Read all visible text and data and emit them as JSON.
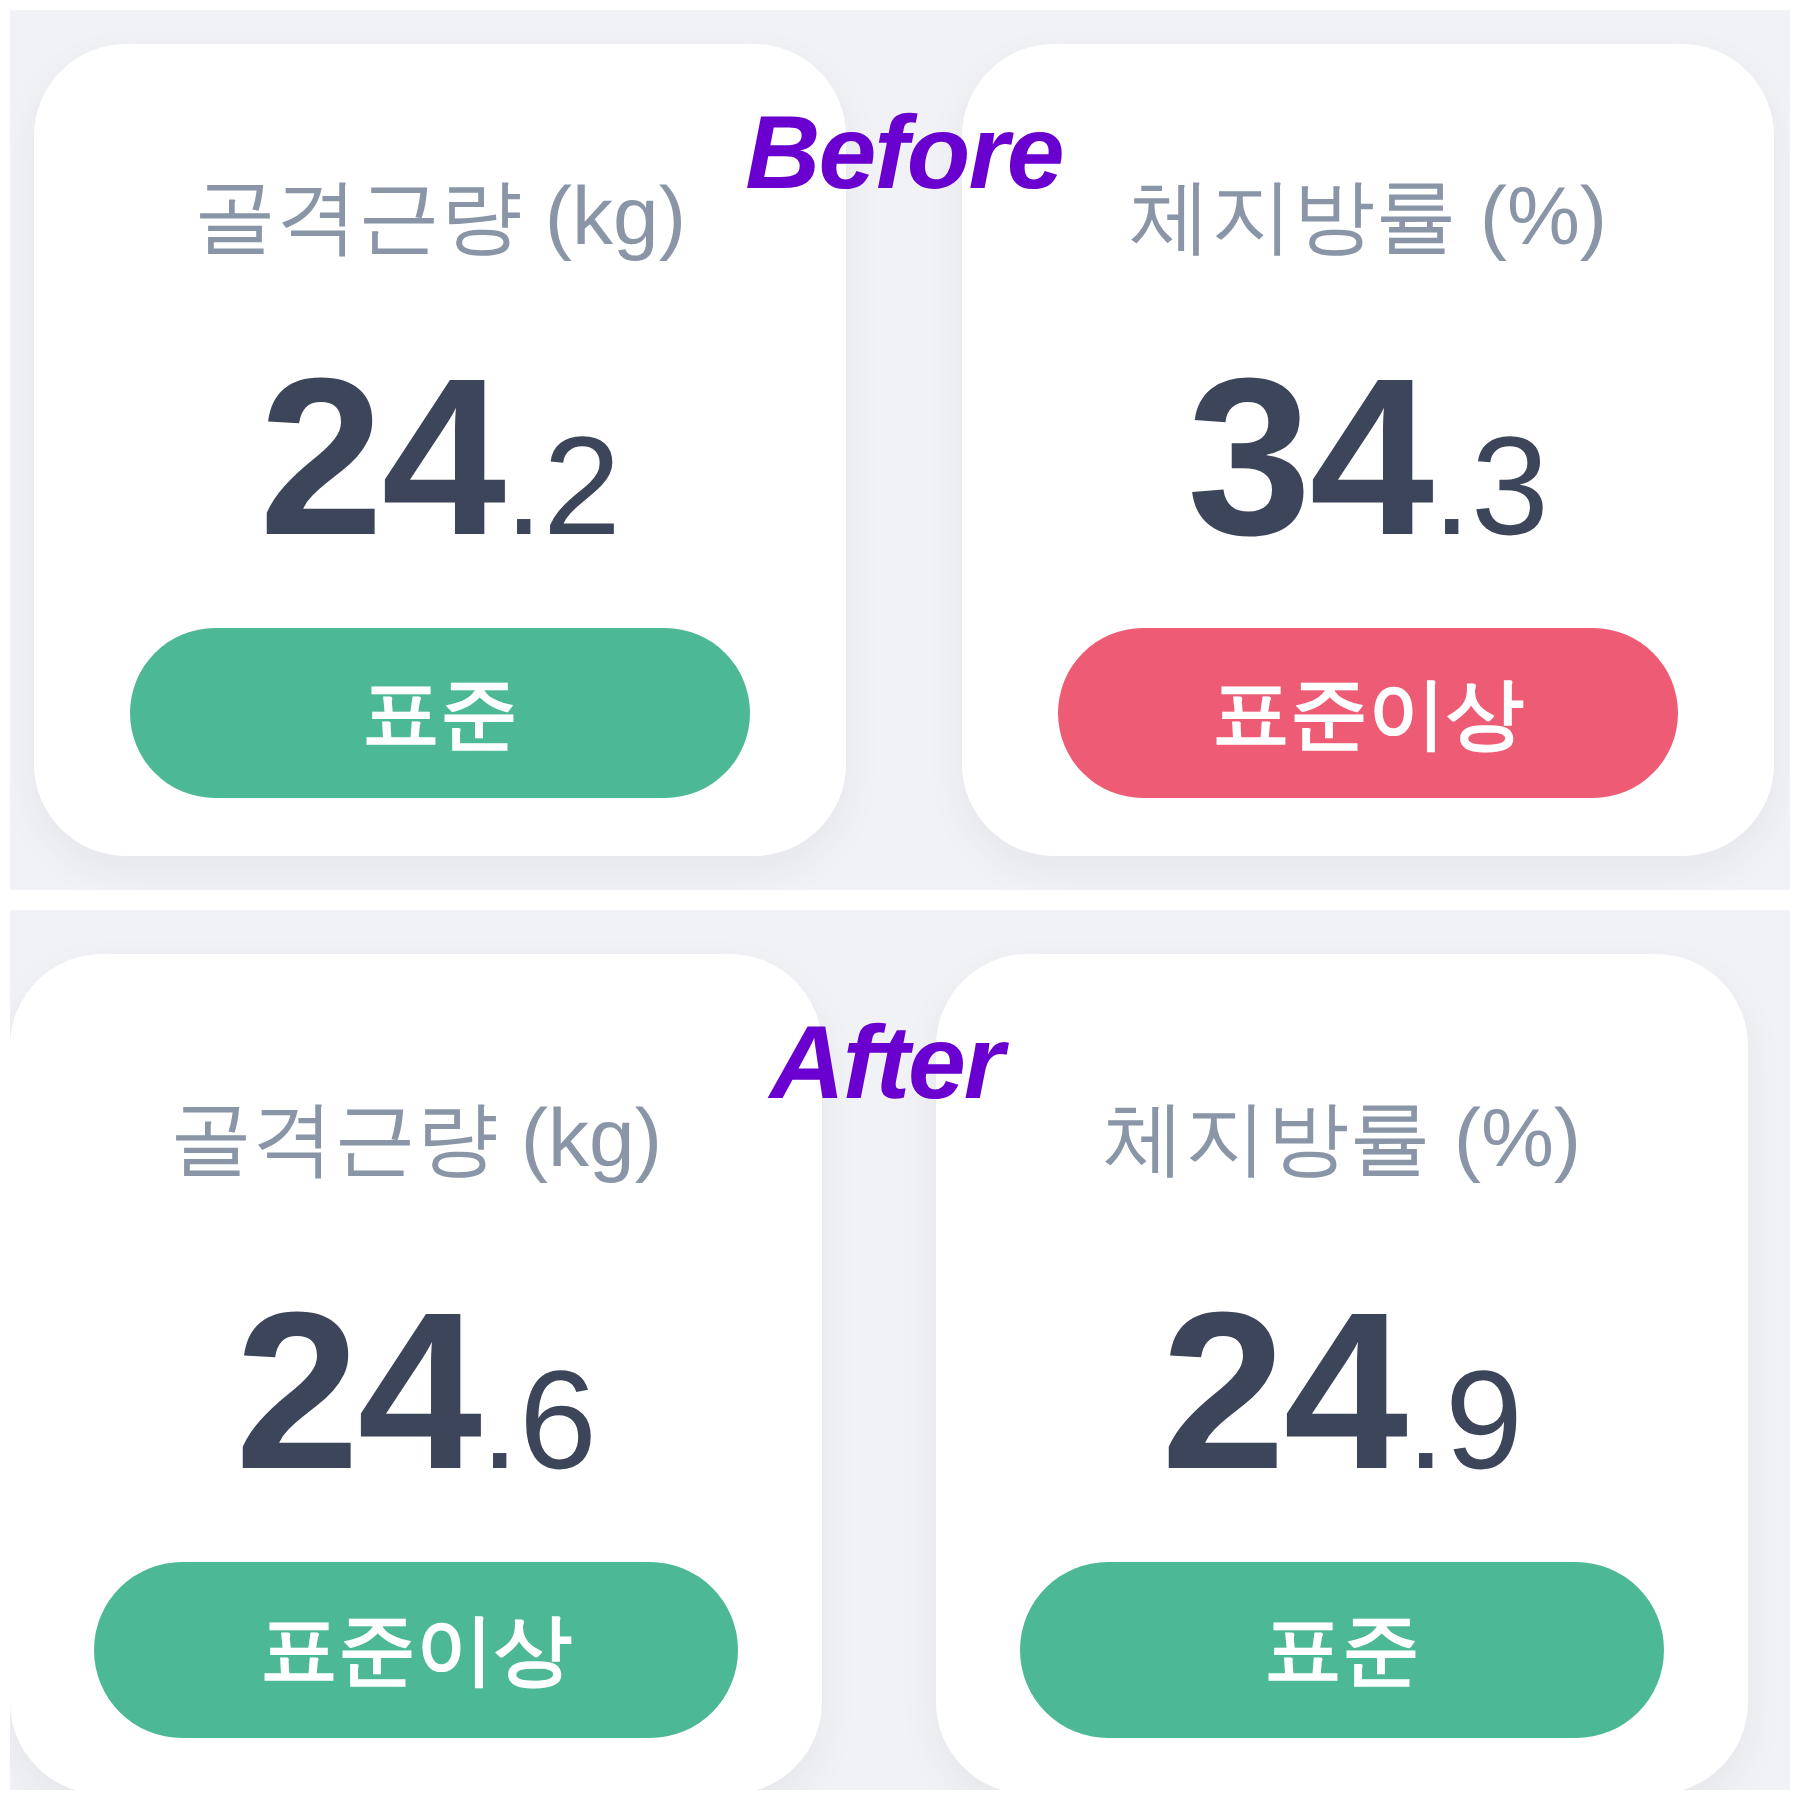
{
  "panels": [
    {
      "caption": "Before",
      "cards": [
        {
          "label": "골격근량 (kg)",
          "value": {
            "whole": "24",
            "fraction": ".2"
          },
          "status": {
            "text": "표준",
            "color": "#4cb896"
          }
        },
        {
          "label": "체지방률 (%)",
          "value": {
            "whole": "34",
            "fraction": ".3"
          },
          "status": {
            "text": "표준이상",
            "color": "#ee5b74"
          }
        }
      ]
    },
    {
      "caption": "After",
      "cards": [
        {
          "label": "골격근량 (kg)",
          "value": {
            "whole": "24",
            "fraction": ".6"
          },
          "status": {
            "text": "표준이상",
            "color": "#4cb896"
          }
        },
        {
          "label": "체지방률 (%)",
          "value": {
            "whole": "24",
            "fraction": ".9"
          },
          "status": {
            "text": "표준",
            "color": "#4cb896"
          }
        }
      ]
    }
  ]
}
